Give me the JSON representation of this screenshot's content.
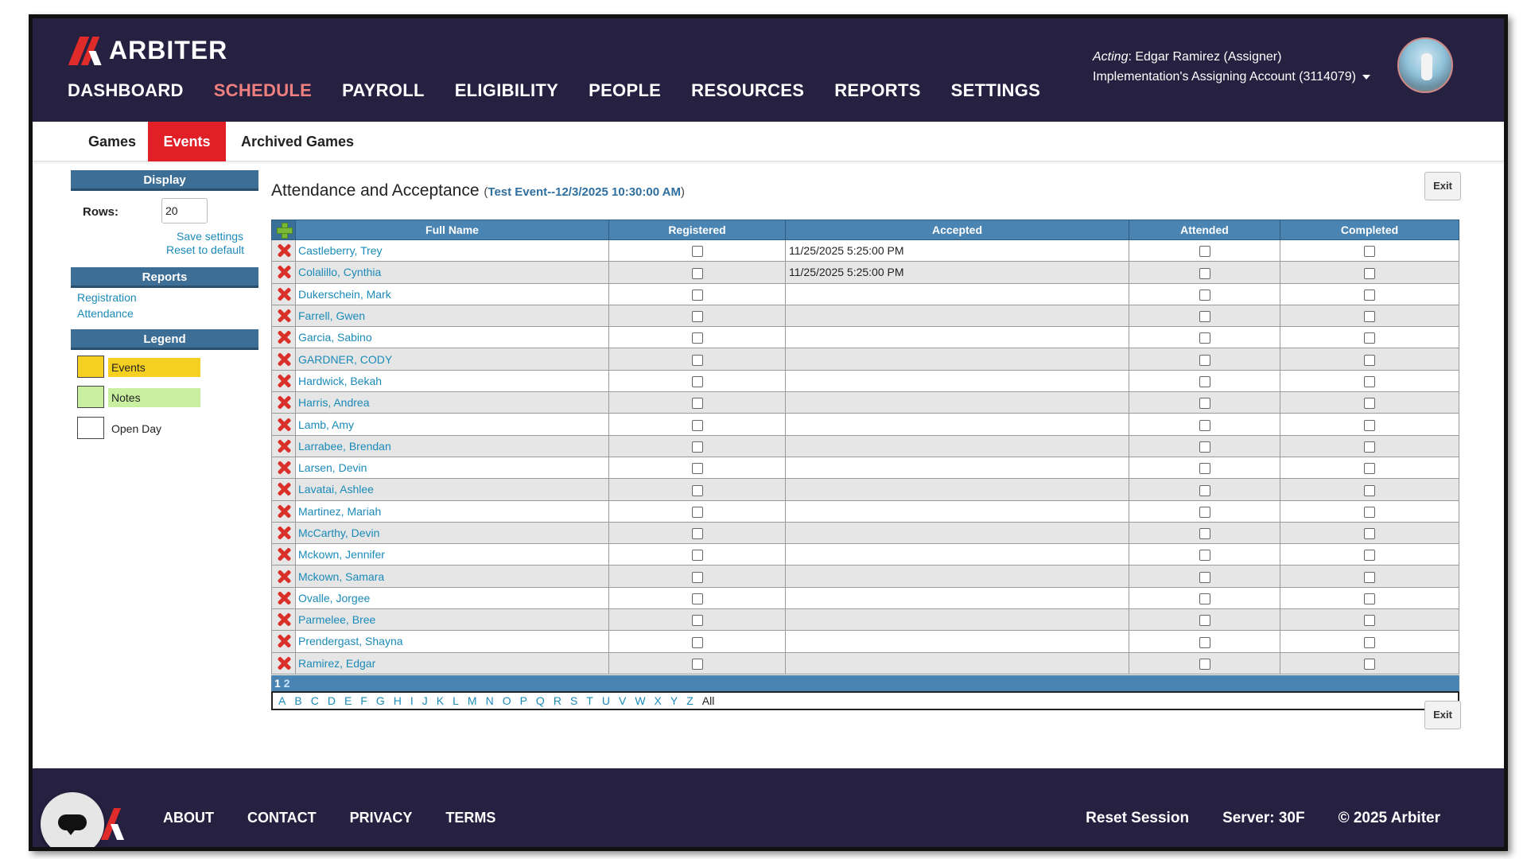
{
  "brand": {
    "name": "ARBITER"
  },
  "nav": [
    "DASHBOARD",
    "SCHEDULE",
    "PAYROLL",
    "ELIGIBILITY",
    "PEOPLE",
    "RESOURCES",
    "REPORTS",
    "SETTINGS"
  ],
  "nav_active": "SCHEDULE",
  "user": {
    "acting_label": "Acting",
    "acting_name": ": Edgar Ramirez (Assigner)",
    "account": "Implementation's Assigning Account (3114079)"
  },
  "subnav": {
    "games": "Games",
    "events": "Events",
    "archived": "Archived Games"
  },
  "sidebar": {
    "display_header": "Display",
    "rows_label": "Rows:",
    "rows_value": "20",
    "save_settings": "Save settings",
    "reset_default": "Reset to default",
    "reports_header": "Reports",
    "registration": "Registration",
    "attendance": "Attendance",
    "legend_header": "Legend",
    "legend": [
      {
        "label": "Events",
        "color": "#f5d020"
      },
      {
        "label": "Notes",
        "color": "#c8f0a0"
      },
      {
        "label": "Open Day",
        "color": "#ffffff"
      }
    ]
  },
  "main": {
    "title": "Attendance and Acceptance",
    "event": "Test Event--12/3/2025 10:30:00 AM",
    "exit_label": "Exit",
    "columns": [
      "Full Name",
      "Registered",
      "Accepted",
      "Attended",
      "Completed"
    ],
    "rows": [
      {
        "name": "Castleberry, Trey",
        "accepted": "11/25/2025 5:25:00 PM"
      },
      {
        "name": "Colalillo, Cynthia",
        "accepted": "11/25/2025 5:25:00 PM"
      },
      {
        "name": "Dukerschein, Mark",
        "accepted": ""
      },
      {
        "name": "Farrell, Gwen",
        "accepted": ""
      },
      {
        "name": "Garcia, Sabino",
        "accepted": ""
      },
      {
        "name": "GARDNER, CODY",
        "accepted": ""
      },
      {
        "name": "Hardwick, Bekah",
        "accepted": ""
      },
      {
        "name": "Harris, Andrea",
        "accepted": ""
      },
      {
        "name": "Lamb, Amy",
        "accepted": ""
      },
      {
        "name": "Larrabee, Brendan",
        "accepted": ""
      },
      {
        "name": "Larsen, Devin",
        "accepted": ""
      },
      {
        "name": "Lavatai, Ashlee",
        "accepted": ""
      },
      {
        "name": "Martinez, Mariah",
        "accepted": ""
      },
      {
        "name": "McCarthy, Devin",
        "accepted": ""
      },
      {
        "name": "Mckown, Jennifer",
        "accepted": ""
      },
      {
        "name": "Mckown, Samara",
        "accepted": ""
      },
      {
        "name": "Ovalle, Jorgee",
        "accepted": ""
      },
      {
        "name": "Parmelee, Bree",
        "accepted": ""
      },
      {
        "name": "Prendergast, Shayna",
        "accepted": ""
      },
      {
        "name": "Ramirez, Edgar",
        "accepted": ""
      }
    ],
    "pages": [
      "1",
      "2"
    ],
    "letters": [
      "A",
      "B",
      "C",
      "D",
      "E",
      "F",
      "G",
      "H",
      "I",
      "J",
      "K",
      "L",
      "M",
      "N",
      "O",
      "P",
      "Q",
      "R",
      "S",
      "T",
      "U",
      "V",
      "W",
      "X",
      "Y",
      "Z",
      "All"
    ]
  },
  "footer": {
    "links": [
      "ABOUT",
      "CONTACT",
      "PRIVACY",
      "TERMS"
    ],
    "reset": "Reset Session",
    "server": "Server: 30F",
    "copyright": "© 2025 Arbiter"
  }
}
